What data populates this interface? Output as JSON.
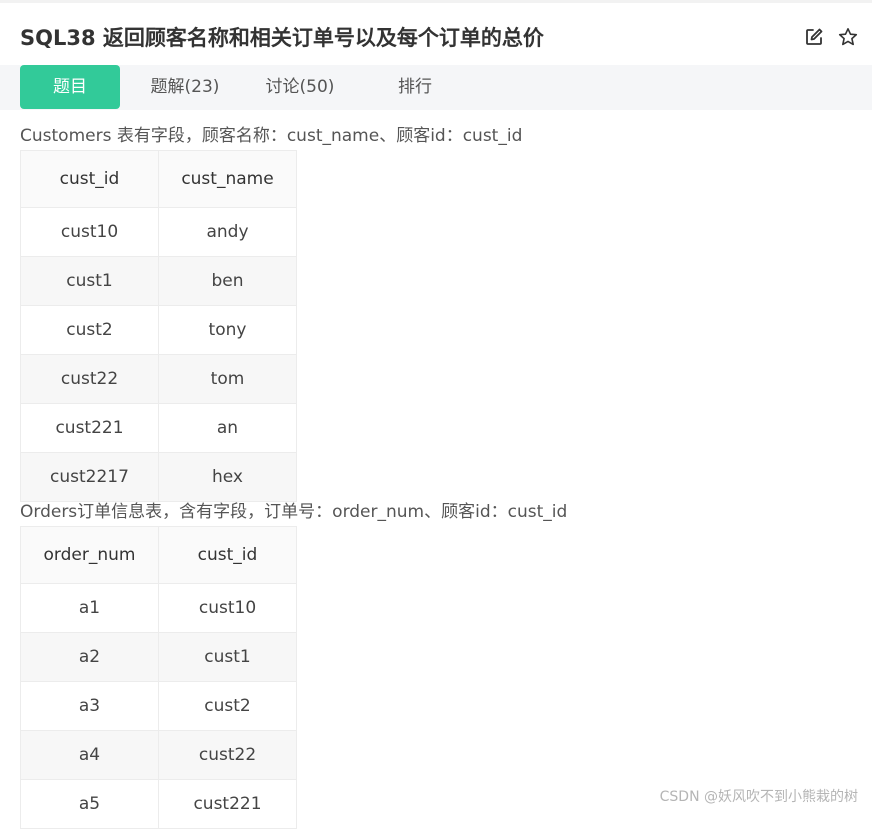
{
  "header": {
    "title": "SQL38  返回顾客名称和相关订单号以及每个订单的总价",
    "icons": [
      "edit-icon",
      "star-icon"
    ]
  },
  "tabs": [
    {
      "label": "题目",
      "active": true
    },
    {
      "label": "题解(23)",
      "active": false
    },
    {
      "label": "讨论(50)",
      "active": false
    },
    {
      "label": "排行",
      "active": false
    }
  ],
  "accent_color": "#32ca99",
  "customers": {
    "description": "Customers 表有字段，顾客名称：cust_name、顾客id：cust_id",
    "headers": [
      "cust_id",
      "cust_name"
    ],
    "rows": [
      [
        "cust10",
        "andy"
      ],
      [
        "cust1",
        "ben"
      ],
      [
        "cust2",
        "tony"
      ],
      [
        "cust22",
        "tom"
      ],
      [
        "cust221",
        "an"
      ],
      [
        "cust2217",
        "hex"
      ]
    ]
  },
  "orders": {
    "description": "Orders订单信息表，含有字段，订单号：order_num、顾客id：cust_id",
    "headers": [
      "order_num",
      "cust_id"
    ],
    "rows": [
      [
        "a1",
        "cust10"
      ],
      [
        "a2",
        "cust1"
      ],
      [
        "a3",
        "cust2"
      ],
      [
        "a4",
        "cust22"
      ],
      [
        "a5",
        "cust221"
      ]
    ]
  },
  "watermark": "CSDN @妖风吹不到小熊栽的树"
}
